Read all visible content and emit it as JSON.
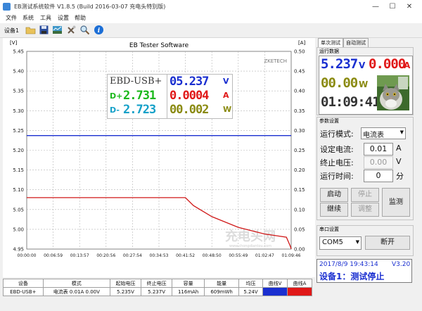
{
  "window": {
    "title": "EB测试系统软件 V1.8.5 (Build 2016-03-07 充电头特别版)",
    "controls": {
      "minimize": "—",
      "maximize": "☐",
      "close": "✕"
    }
  },
  "menu": [
    "文件",
    "系统",
    "工具",
    "设置",
    "帮助"
  ],
  "toolbar": {
    "device_label": "设备1"
  },
  "chart": {
    "title": "EB Tester Software",
    "left_unit": "[V]",
    "right_unit": "[A]",
    "brand": "ZKETECH",
    "watermark": "充电头网",
    "watermark_url": "www.chongdiantou.com",
    "overlay": {
      "model": "EBD-USB+",
      "voltage": "05.237",
      "voltage_unit": "V",
      "dplus_label": "D+",
      "dplus": "2.731",
      "current": "0.0004",
      "current_unit": "A",
      "dminus_label": "D-",
      "dminus": "2.723",
      "power": "00.002",
      "power_unit": "W"
    }
  },
  "chart_data": {
    "type": "line",
    "title": "EB Tester Software",
    "xlabel": "",
    "ylabel": "[V]",
    "y2label": "[A]",
    "x_ticks": [
      "00:00:00",
      "00:06:59",
      "00:13:57",
      "00:20:56",
      "00:27:54",
      "00:34:53",
      "00:41:52",
      "00:48:50",
      "00:55:49",
      "01:02:47",
      "01:09:46"
    ],
    "x_range_seconds": [
      0,
      4186
    ],
    "ylim": [
      4.95,
      5.45
    ],
    "y_ticks": [
      "5.45",
      "5.40",
      "5.35",
      "5.30",
      "5.25",
      "5.20",
      "5.15",
      "5.10",
      "5.05",
      "5.00",
      "4.95"
    ],
    "y2lim": [
      0,
      0.5
    ],
    "y2_ticks": [
      "0.50",
      "0.45",
      "0.40",
      "0.35",
      "0.30",
      "0.25",
      "0.20",
      "0.15",
      "0.10",
      "0.05",
      "0.00"
    ],
    "grid": true,
    "series": [
      {
        "axis": "left",
        "color": "#1a2fd0",
        "x": [
          "00:00:00",
          "00:41:52",
          "01:09:46"
        ],
        "y": [
          5.237,
          5.237,
          5.237
        ]
      },
      {
        "axis": "right",
        "color": "#d01818",
        "x": [
          "00:00:00",
          "00:41:52",
          "00:44:00",
          "00:48:50",
          "00:55:49",
          "01:02:47",
          "01:08:30",
          "01:09:30",
          "01:09:46"
        ],
        "y": [
          0.13,
          0.13,
          0.11,
          0.082,
          0.055,
          0.038,
          0.03,
          0.008,
          0.0004
        ]
      }
    ]
  },
  "table": {
    "headers": [
      "设备",
      "模式",
      "起始电压",
      "终止电压",
      "容量",
      "能量",
      "均压",
      "曲线V",
      "曲线A"
    ],
    "rows": [
      {
        "device": "EBD-USB+",
        "mode": "电流表  0.01A  0.00V",
        "start_v": "5.235V",
        "end_v": "5.237V",
        "capacity": "116mAh",
        "energy": "609mWh",
        "avg_v": "5.24V",
        "curve_v_color": "#1a2fd0",
        "curve_a_color": "#e01818"
      }
    ]
  },
  "tabs": [
    {
      "label": "单次测试",
      "active": true
    },
    {
      "label": "自动测试",
      "active": false
    }
  ],
  "live": {
    "group_label": "运行数据",
    "voltage": "5.237",
    "voltage_unit": "V",
    "current": "0.000",
    "current_unit": "A",
    "power": "00.00",
    "power_unit": "W",
    "time": "01:09:41"
  },
  "params": {
    "group_label": "参数设置",
    "mode_label": "运行模式:",
    "mode_value": "电流表",
    "current_label": "设定电流:",
    "current_value": "0.01",
    "current_unit": "A",
    "stop_label": "终止电压:",
    "stop_value": "0.00",
    "stop_unit": "V",
    "runtime_label": "运行时间:",
    "runtime_value": "0",
    "runtime_unit": "分",
    "buttons": {
      "start": "启动",
      "stop": "停止",
      "resume": "继续",
      "adjust": "调整",
      "monitor": "监测"
    }
  },
  "serial": {
    "group_label": "串口设置",
    "port": "COM5",
    "disconnect": "断开"
  },
  "status": {
    "datetime": "2017/8/9 19:43:14",
    "version": "V3.20",
    "message": "设备1：测试停止"
  },
  "colors": {
    "voltage": "#1a2fd0",
    "current": "#e01818",
    "power": "#8a8a10",
    "time": "#333333",
    "dplus": "#1bb81b",
    "dminus": "#14a0c8"
  }
}
